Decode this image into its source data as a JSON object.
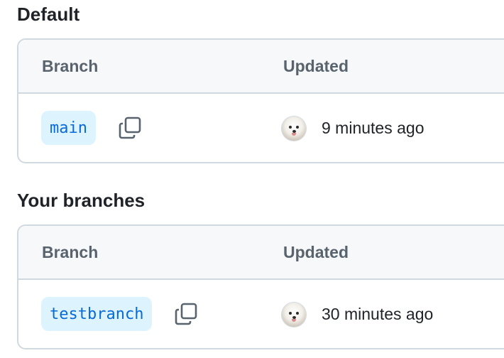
{
  "sections": [
    {
      "title": "Default",
      "header": {
        "branch_label": "Branch",
        "updated_label": "Updated"
      },
      "rows": [
        {
          "branch": "main",
          "updated": "9 minutes ago",
          "copy_icon": "copy-icon",
          "avatar": "user-avatar"
        }
      ]
    },
    {
      "title": "Your branches",
      "header": {
        "branch_label": "Branch",
        "updated_label": "Updated"
      },
      "rows": [
        {
          "branch": "testbranch",
          "updated": "30 minutes ago",
          "copy_icon": "copy-icon",
          "avatar": "user-avatar"
        }
      ]
    }
  ],
  "colors": {
    "pill_bg": "#ddf4ff",
    "pill_text": "#0969da",
    "header_bg": "#f6f8fa",
    "border": "#d1d9e0",
    "muted_text": "#59636e"
  }
}
